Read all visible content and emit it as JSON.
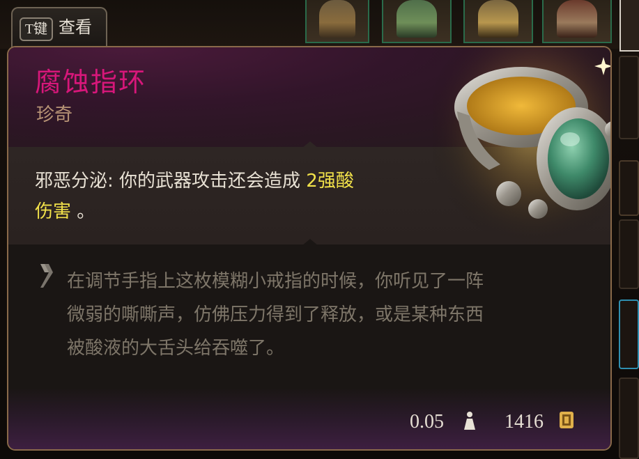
{
  "view_hint": {
    "key": "T键",
    "label": "查看"
  },
  "item": {
    "name": "腐蚀指环",
    "rarity": "珍奇",
    "rarity_color": "#d7177a",
    "icon": "ring-icon",
    "effect": {
      "name": "邪恶分泌:",
      "text_before": " 你的武器攻击还会造成 ",
      "highlight": "2强酸",
      "highlight_line2": "伤害",
      "text_after": " 。"
    },
    "flavor_text_lines": [
      "在调节手指上这枚模糊小戒指的时候，你听见了一阵",
      "微弱的嘶嘶声，仿佛压力得到了释放，或是某种东西",
      "被酸液的大舌头给吞噬了。"
    ],
    "weight": "0.05",
    "weight_icon": "weight-icon",
    "price": "1416",
    "price_icon": "gold-coin-icon"
  },
  "colors": {
    "highlight": "#f2e24a",
    "border": "#8a6a4a"
  }
}
